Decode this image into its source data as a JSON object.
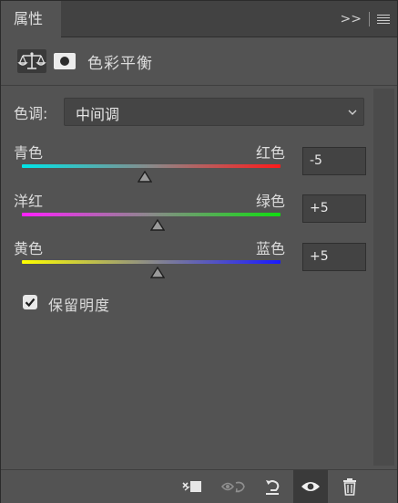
{
  "panel": {
    "tab_label": "属性",
    "expand_glyph": ">>"
  },
  "header": {
    "title": "色彩平衡"
  },
  "tone": {
    "label": "色调:",
    "selected": "中间调"
  },
  "sliders": [
    {
      "left": "青色",
      "right": "红色",
      "value": "-5",
      "level": -5,
      "colors": [
        "#00e5e8",
        "#ff1a1a"
      ]
    },
    {
      "left": "洋红",
      "right": "绿色",
      "value": "+5",
      "level": 5,
      "colors": [
        "#ff20ff",
        "#11dd11"
      ]
    },
    {
      "left": "黄色",
      "right": "蓝色",
      "value": "+5",
      "level": 5,
      "colors": [
        "#ffff00",
        "#1a1aff"
      ]
    }
  ],
  "preserve": {
    "label": "保留明度",
    "checked": true
  },
  "footer": {
    "icons": [
      "clip-to-layer-icon",
      "toggle-previous-state-icon",
      "reset-icon",
      "visibility-eye-icon",
      "trash-icon"
    ]
  }
}
